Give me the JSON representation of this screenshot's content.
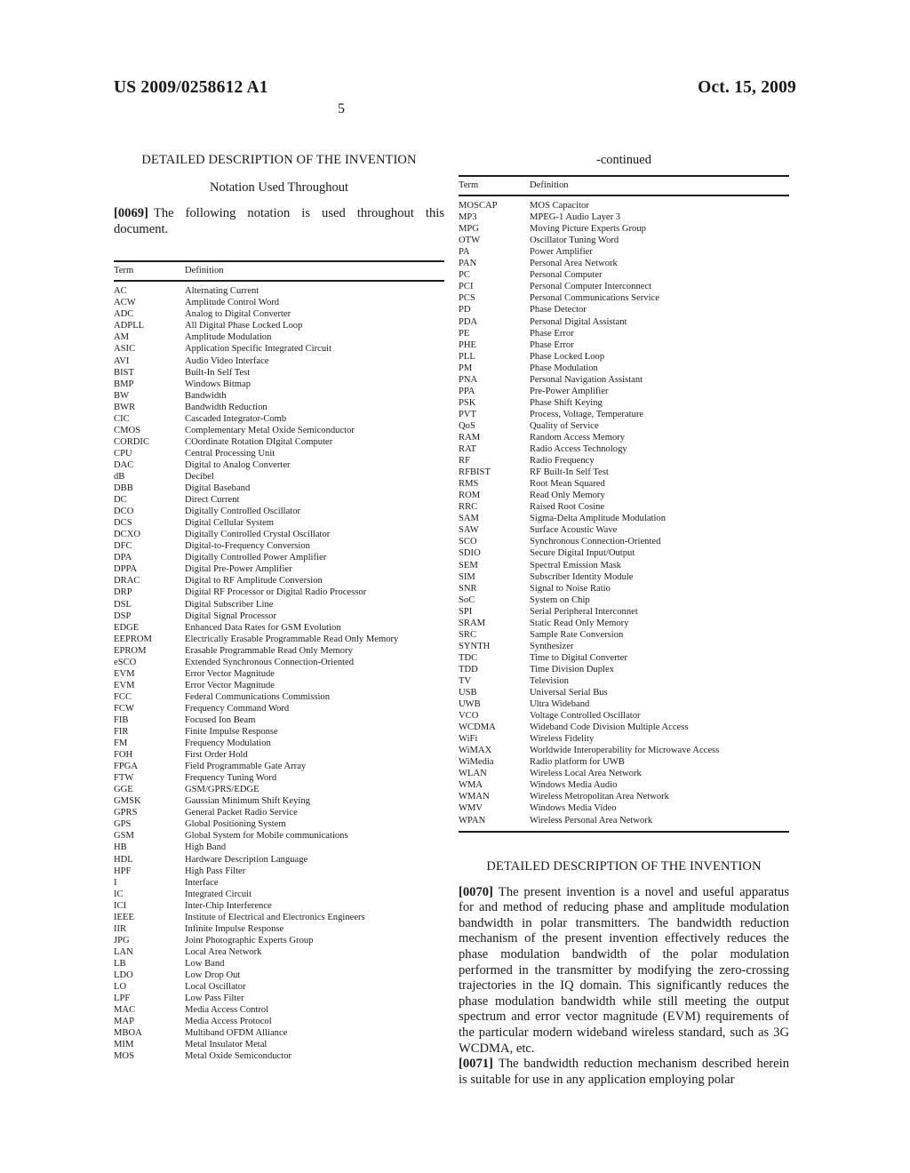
{
  "header": {
    "publication_number": "US 2009/0258612 A1",
    "publication_date": "Oct. 15, 2009",
    "page_number": "5"
  },
  "left_column": {
    "section_heading": "DETAILED DESCRIPTION OF THE INVENTION",
    "sub_heading": "Notation Used Throughout",
    "paragraph": {
      "number": "[0069]",
      "text": "The following notation is used throughout this document."
    },
    "table": {
      "columns": [
        "Term",
        "Definition"
      ],
      "rows": [
        [
          "AC",
          "Alternating Current"
        ],
        [
          "ACW",
          "Amplitude Control Word"
        ],
        [
          "ADC",
          "Analog to Digital Converter"
        ],
        [
          "ADPLL",
          "All Digital Phase Locked Loop"
        ],
        [
          "AM",
          "Amplitude Modulation"
        ],
        [
          "ASIC",
          "Application Specific Integrated Circuit"
        ],
        [
          "AVI",
          "Audio Video Interface"
        ],
        [
          "BIST",
          "Built-In Self Test"
        ],
        [
          "BMP",
          "Windows Bitmap"
        ],
        [
          "BW",
          "Bandwidth"
        ],
        [
          "BWR",
          "Bandwidth Reduction"
        ],
        [
          "CIC",
          "Cascaded Integrator-Comb"
        ],
        [
          "CMOS",
          "Complementary Metal Oxide Semiconductor"
        ],
        [
          "CORDIC",
          "COordinate Rotation DIgital Computer"
        ],
        [
          "CPU",
          "Central Processing Unit"
        ],
        [
          "DAC",
          "Digital to Analog Converter"
        ],
        [
          "dB",
          "Decibel"
        ],
        [
          "DBB",
          "Digital Baseband"
        ],
        [
          "DC",
          "Direct Current"
        ],
        [
          "DCO",
          "Digitally Controlled Oscillator"
        ],
        [
          "DCS",
          "Digital Cellular System"
        ],
        [
          "DCXO",
          "Digitally Controlled Crystal Oscillator"
        ],
        [
          "DFC",
          "Digital-to-Frequency Conversion"
        ],
        [
          "DPA",
          "Digitally Controlled Power Amplifier"
        ],
        [
          "DPPA",
          "Digital Pre-Power Amplifier"
        ],
        [
          "DRAC",
          "Digital to RF Amplitude Conversion"
        ],
        [
          "DRP",
          "Digital RF Processor or Digital Radio Processor"
        ],
        [
          "DSL",
          "Digital Subscriber Line"
        ],
        [
          "DSP",
          "Digital Signal Processor"
        ],
        [
          "EDGE",
          "Enhanced Data Rates for GSM Evolution"
        ],
        [
          "EEPROM",
          "Electrically Erasable Programmable Read Only Memory"
        ],
        [
          "EPROM",
          "Erasable Programmable Read Only Memory"
        ],
        [
          "eSCO",
          "Extended Synchronous Connection-Oriented"
        ],
        [
          "EVM",
          "Error Vector Magnitude"
        ],
        [
          "EVM",
          "Error Vector Magnitude"
        ],
        [
          "FCC",
          "Federal Communications Commission"
        ],
        [
          "FCW",
          "Frequency Command Word"
        ],
        [
          "FIB",
          "Focused Ion Beam"
        ],
        [
          "FIR",
          "Finite Impulse Response"
        ],
        [
          "FM",
          "Frequency Modulation"
        ],
        [
          "FOH",
          "First Order Hold"
        ],
        [
          "FPGA",
          "Field Programmable Gate Array"
        ],
        [
          "FTW",
          "Frequency Tuning Word"
        ],
        [
          "GGE",
          "GSM/GPRS/EDGE"
        ],
        [
          "GMSK",
          "Gaussian Minimum Shift Keying"
        ],
        [
          "GPRS",
          "General Packet Radio Service"
        ],
        [
          "GPS",
          "Global Positioning System"
        ],
        [
          "GSM",
          "Global System for Mobile communications"
        ],
        [
          "HB",
          "High Band"
        ],
        [
          "HDL",
          "Hardware Description Language"
        ],
        [
          "HPF",
          "High Pass Filter"
        ],
        [
          "I",
          "Interface"
        ],
        [
          "IC",
          "Integrated Circuit"
        ],
        [
          "ICI",
          "Inter-Chip Interference"
        ],
        [
          "IEEE",
          "Institute of Electrical and Electronics Engineers"
        ],
        [
          "IIR",
          "Infinite Impulse Response"
        ],
        [
          "JPG",
          "Joint Photographic Experts Group"
        ],
        [
          "LAN",
          "Local Area Network"
        ],
        [
          "LB",
          "Low Band"
        ],
        [
          "LDO",
          "Low Drop Out"
        ],
        [
          "LO",
          "Local Oscillator"
        ],
        [
          "LPF",
          "Low Pass Filter"
        ],
        [
          "MAC",
          "Media Access Control"
        ],
        [
          "MAP",
          "Media Access Protocol"
        ],
        [
          "MBOA",
          "Multiband OFDM Alliance"
        ],
        [
          "MIM",
          "Metal Insulator Metal"
        ],
        [
          "MOS",
          "Metal Oxide Semiconductor"
        ]
      ]
    }
  },
  "right_column": {
    "table_continued_label": "-continued",
    "table": {
      "columns": [
        "Term",
        "Definition"
      ],
      "rows": [
        [
          "MOSCAP",
          "MOS Capacitor"
        ],
        [
          "MP3",
          "MPEG-1 Audio Layer 3"
        ],
        [
          "MPG",
          "Moving Picture Experts Group"
        ],
        [
          "OTW",
          "Oscillator Tuning Word"
        ],
        [
          "PA",
          "Power Amplifier"
        ],
        [
          "PAN",
          "Personal Area Network"
        ],
        [
          "PC",
          "Personal Computer"
        ],
        [
          "PCI",
          "Personal Computer Interconnect"
        ],
        [
          "PCS",
          "Personal Communications Service"
        ],
        [
          "PD",
          "Phase Detector"
        ],
        [
          "PDA",
          "Personal Digital Assistant"
        ],
        [
          "PE",
          "Phase Error"
        ],
        [
          "PHE",
          "Phase Error"
        ],
        [
          "PLL",
          "Phase Locked Loop"
        ],
        [
          "PM",
          "Phase Modulation"
        ],
        [
          "PNA",
          "Personal Navigation Assistant"
        ],
        [
          "PPA",
          "Pre-Power Amplifier"
        ],
        [
          "PSK",
          "Phase Shift Keying"
        ],
        [
          "PVT",
          "Process, Voltage, Temperature"
        ],
        [
          "QoS",
          "Quality of Service"
        ],
        [
          "RAM",
          "Random Access Memory"
        ],
        [
          "RAT",
          "Radio Access Technology"
        ],
        [
          "RF",
          "Radio Frequency"
        ],
        [
          "RFBIST",
          "RF Built-In Self Test"
        ],
        [
          "RMS",
          "Root Mean Squared"
        ],
        [
          "ROM",
          "Read Only Memory"
        ],
        [
          "RRC",
          "Raised Root Cosine"
        ],
        [
          "SAM",
          "Sigma-Delta Amplitude Modulation"
        ],
        [
          "SAW",
          "Surface Acoustic Wave"
        ],
        [
          "SCO",
          "Synchronous Connection-Oriented"
        ],
        [
          "SDIO",
          "Secure Digital Input/Output"
        ],
        [
          "SEM",
          "Spectral Emission Mask"
        ],
        [
          "SIM",
          "Subscriber Identity Module"
        ],
        [
          "SNR",
          "Signal to Noise Ratio"
        ],
        [
          "SoC",
          "System on Chip"
        ],
        [
          "SPI",
          "Serial Peripheral Interconnet"
        ],
        [
          "SRAM",
          "Static Read Only Memory"
        ],
        [
          "SRC",
          "Sample Rate Conversion"
        ],
        [
          "SYNTH",
          "Synthesizer"
        ],
        [
          "TDC",
          "Time to Digital Converter"
        ],
        [
          "TDD",
          "Time Division Duplex"
        ],
        [
          "TV",
          "Television"
        ],
        [
          "USB",
          "Universal Serial Bus"
        ],
        [
          "UWB",
          "Ultra Wideband"
        ],
        [
          "VCO",
          "Voltage Controlled Oscillator"
        ],
        [
          "WCDMA",
          "Wideband Code Division Multiple Access"
        ],
        [
          "WiFi",
          "Wireless Fidelity"
        ],
        [
          "WiMAX",
          "Worldwide Interoperability for Microwave Access"
        ],
        [
          "WiMedia",
          "Radio platform for UWB"
        ],
        [
          "WLAN",
          "Wireless Local Area Network"
        ],
        [
          "WMA",
          "Windows Media Audio"
        ],
        [
          "WMAN",
          "Wireless Metropolitan Area Network"
        ],
        [
          "WMV",
          "Windows Media Video"
        ],
        [
          "WPAN",
          "Wireless Personal Area Network"
        ]
      ]
    },
    "section_heading": "DETAILED DESCRIPTION OF THE INVENTION",
    "paragraphs": [
      {
        "number": "[0070]",
        "text": "The present invention is a novel and useful apparatus for and method of reducing phase and amplitude modulation bandwidth in polar transmitters. The bandwidth reduction mechanism of the present invention effectively reduces the phase modulation bandwidth of the polar modulation performed in the transmitter by modifying the zero-crossing trajectories in the IQ domain. This significantly reduces the phase modulation bandwidth while still meeting the output spectrum and error vector magnitude (EVM) requirements of the particular modern wideband wireless standard, such as 3G WCDMA, etc."
      },
      {
        "number": "[0071]",
        "text": "The bandwidth reduction mechanism described herein is suitable for use in any application employing polar"
      }
    ]
  }
}
